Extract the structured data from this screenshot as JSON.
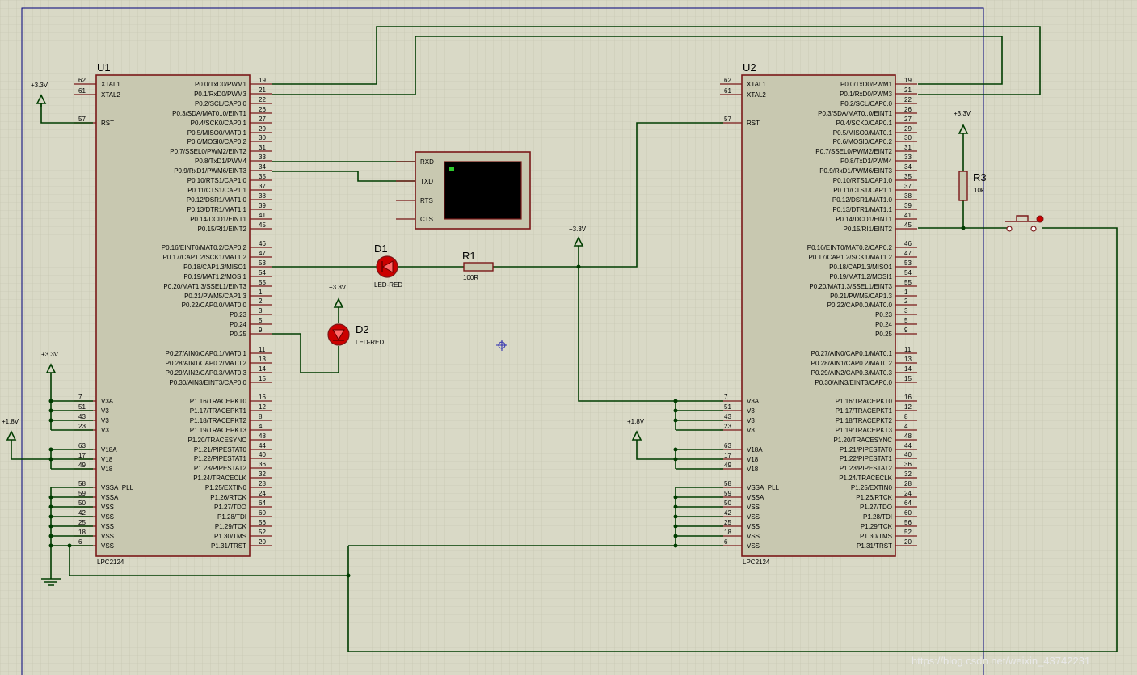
{
  "u1": {
    "ref": "U1",
    "part": "LPC2124"
  },
  "u2": {
    "ref": "U2",
    "part": "LPC2124"
  },
  "left_pins": [
    {
      "name": "XTAL1",
      "num": "62"
    },
    {
      "name": "XTAL2",
      "num": "61"
    },
    {
      "name": "RST",
      "num": "57"
    },
    {
      "name": "V3A",
      "num": "7"
    },
    {
      "name": "V3",
      "num": "51"
    },
    {
      "name": "V3",
      "num": "43"
    },
    {
      "name": "V3",
      "num": "23"
    },
    {
      "name": "V18A",
      "num": "63"
    },
    {
      "name": "V18",
      "num": "17"
    },
    {
      "name": "V18",
      "num": "49"
    },
    {
      "name": "VSSA_PLL",
      "num": "58"
    },
    {
      "name": "VSSA",
      "num": "59"
    },
    {
      "name": "VSS",
      "num": "50"
    },
    {
      "name": "VSS",
      "num": "42"
    },
    {
      "name": "VSS",
      "num": "25"
    },
    {
      "name": "VSS",
      "num": "18"
    },
    {
      "name": "VSS",
      "num": "6"
    }
  ],
  "right_pins": [
    {
      "name": "P0.0/TxD0/PWM1",
      "num": "19"
    },
    {
      "name": "P0.1/RxD0/PWM3",
      "num": "21"
    },
    {
      "name": "P0.2/SCL/CAP0.0",
      "num": "22"
    },
    {
      "name": "P0.3/SDA/MAT0..0/EINT1",
      "num": "26"
    },
    {
      "name": "P0.4/SCK0/CAP0.1",
      "num": "27"
    },
    {
      "name": "P0.5/MISO0/MAT0.1",
      "num": "29"
    },
    {
      "name": "P0.6/MOSI0/CAP0.2",
      "num": "30"
    },
    {
      "name": "P0.7/SSEL0/PWM2/EINT2",
      "num": "31"
    },
    {
      "name": "P0.8/TxD1/PWM4",
      "num": "33"
    },
    {
      "name": "P0.9/RxD1/PWM6/EINT3",
      "num": "34"
    },
    {
      "name": "P0.10/RTS1/CAP1.0",
      "num": "35"
    },
    {
      "name": "P0.11/CTS1/CAP1.1",
      "num": "37"
    },
    {
      "name": "P0.12/DSR1/MAT1.0",
      "num": "38"
    },
    {
      "name": "P0.13/DTR1/MAT1.1",
      "num": "39"
    },
    {
      "name": "P0.14/DCD1/EINT1",
      "num": "41"
    },
    {
      "name": "P0.15/RI1/EINT2",
      "num": "45"
    },
    {
      "name": "P0.16/EINT0/MAT0.2/CAP0.2",
      "num": "46"
    },
    {
      "name": "P0.17/CAP1.2/SCK1/MAT1.2",
      "num": "47"
    },
    {
      "name": "P0.18/CAP1.3/MISO1",
      "num": "53"
    },
    {
      "name": "P0.19/MAT1.2/MOSI1",
      "num": "54"
    },
    {
      "name": "P0.20/MAT1.3/SSEL1/EINT3",
      "num": "55"
    },
    {
      "name": "P0.21/PWM5/CAP1.3",
      "num": "1"
    },
    {
      "name": "P0.22/CAP0.0/MAT0.0",
      "num": "2"
    },
    {
      "name": "P0.23",
      "num": "3"
    },
    {
      "name": "P0.24",
      "num": "5"
    },
    {
      "name": "P0.25",
      "num": "9"
    },
    {
      "name": "P0.27/AIN0/CAP0.1/MAT0.1",
      "num": "11"
    },
    {
      "name": "P0.28/AIN1/CAP0.2/MAT0.2",
      "num": "13"
    },
    {
      "name": "P0.29/AIN2/CAP0.3/MAT0.3",
      "num": "14"
    },
    {
      "name": "P0.30/AIN3/EINT3/CAP0.0",
      "num": "15"
    },
    {
      "name": "P1.16/TRACEPKT0",
      "num": "16"
    },
    {
      "name": "P1.17/TRACEPKT1",
      "num": "12"
    },
    {
      "name": "P1.18/TRACEPKT2",
      "num": "8"
    },
    {
      "name": "P1.19/TRACEPKT3",
      "num": "4"
    },
    {
      "name": "P1.20/TRACESYNC",
      "num": "48"
    },
    {
      "name": "P1.21/PIPESTAT0",
      "num": "44"
    },
    {
      "name": "P1.22/PIPESTAT1",
      "num": "40"
    },
    {
      "name": "P1.23/PIPESTAT2",
      "num": "36"
    },
    {
      "name": "P1.24/TRACECLK",
      "num": "32"
    },
    {
      "name": "P1.25/EXTIN0",
      "num": "28"
    },
    {
      "name": "P1.26/RTCK",
      "num": "24"
    },
    {
      "name": "P1.27/TDO",
      "num": "64"
    },
    {
      "name": "P1.28/TDI",
      "num": "60"
    },
    {
      "name": "P1.29/TCK",
      "num": "56"
    },
    {
      "name": "P1.30/TMS",
      "num": "52"
    },
    {
      "name": "P1.31/TRST",
      "num": "20"
    }
  ],
  "terminal": {
    "pins": [
      "RXD",
      "TXD",
      "RTS",
      "CTS"
    ]
  },
  "d1": {
    "ref": "D1",
    "value": "LED-RED"
  },
  "d2": {
    "ref": "D2",
    "value": "LED-RED"
  },
  "r1": {
    "ref": "R1",
    "value": "100R"
  },
  "r3": {
    "ref": "R3",
    "value": "10k"
  },
  "power": {
    "v33": "+3.3V",
    "v18": "+1.8V"
  },
  "watermark": "https://blog.csdn.net/weixin_43742231",
  "colors": {
    "background": "#d9d9c6",
    "grid": "#c8c8b4",
    "wire": "#003d00",
    "body_fill": "#c8c8b0",
    "body_stroke": "#7a1818",
    "led": "#cc0000",
    "frame": "#00007a"
  }
}
